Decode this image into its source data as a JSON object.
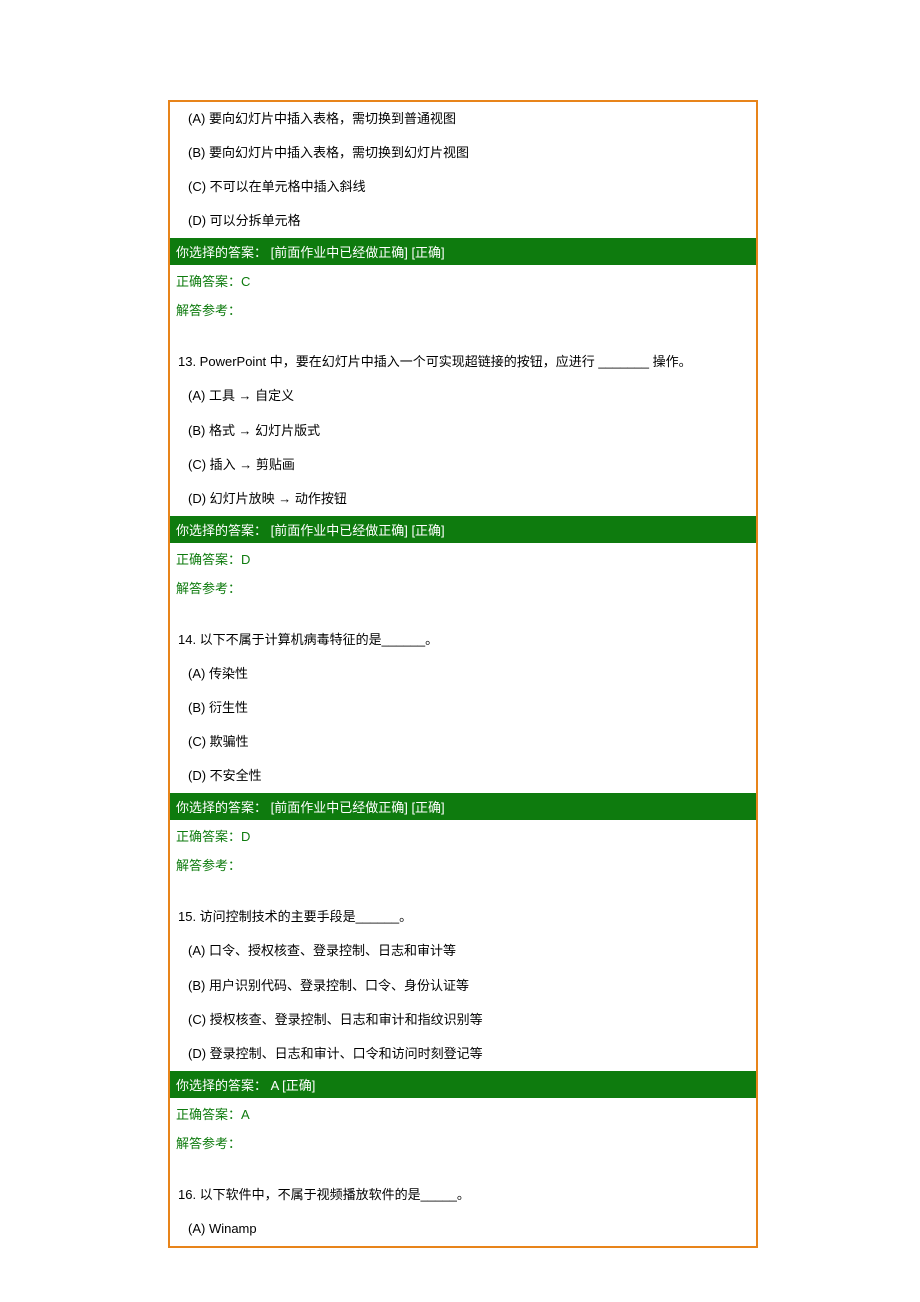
{
  "q12": {
    "optA": "(A) 要向幻灯片中插入表格，需切换到普通视图",
    "optB": "(B) 要向幻灯片中插入表格，需切换到幻灯片视图",
    "optC": "(C) 不可以在单元格中插入斜线",
    "optD": "(D) 可以分拆单元格",
    "selected": "你选择的答案：  [前面作业中已经做正确]  [正确]",
    "correct": "正确答案：C",
    "ref": "解答参考："
  },
  "q13": {
    "stem": "13.  PowerPoint  中，要在幻灯片中插入一个可实现超链接的按钮，应进行  _______  操作。",
    "optA": "(A) 工具  →  自定义",
    "optB": "(B) 格式  →  幻灯片版式",
    "optC": "(C) 插入  →  剪贴画",
    "optD": "(D) 幻灯片放映  →  动作按钮",
    "selected": "你选择的答案：  [前面作业中已经做正确]  [正确]",
    "correct": "正确答案：D",
    "ref": "解答参考："
  },
  "q14": {
    "stem": "14.  以下不属于计算机病毒特征的是______。",
    "optA": "(A) 传染性",
    "optB": "(B) 衍生性",
    "optC": "(C) 欺骗性",
    "optD": "(D) 不安全性",
    "selected": "你选择的答案：  [前面作业中已经做正确]  [正确]",
    "correct": "正确答案：D",
    "ref": "解答参考："
  },
  "q15": {
    "stem": "15.  访问控制技术的主要手段是______。",
    "optA": "(A) 口令、授权核查、登录控制、日志和审计等",
    "optB": "(B) 用户识别代码、登录控制、口令、身份认证等",
    "optC": "(C) 授权核查、登录控制、日志和审计和指纹识别等",
    "optD": "(D) 登录控制、日志和审计、口令和访问时刻登记等",
    "selected": "你选择的答案：  A  [正确]",
    "correct": "正确答案：A",
    "ref": "解答参考："
  },
  "q16": {
    "stem": "16.  以下软件中，不属于视频播放软件的是_____。",
    "optA": "(A) Winamp"
  }
}
